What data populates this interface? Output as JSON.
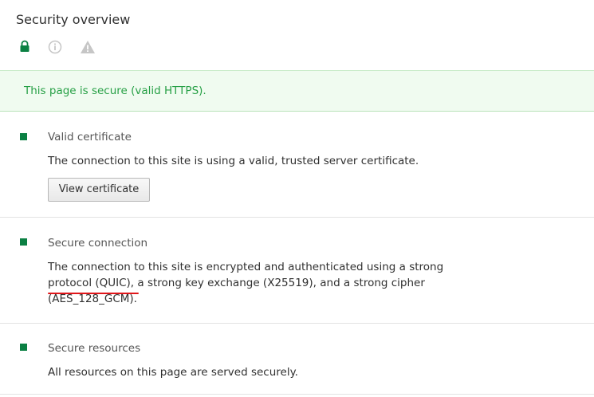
{
  "panel": {
    "title": "Security overview",
    "icons": {
      "secure": "lock-icon",
      "info": "info-icon",
      "warning": "warning-icon"
    }
  },
  "summary": {
    "text": "This page is secure (valid HTTPS)."
  },
  "sections": [
    {
      "title": "Valid certificate",
      "body_lines": [
        "The connection to this site is using a valid, trusted server certificate."
      ],
      "button_label": "View certificate"
    },
    {
      "title": "Secure connection",
      "body_lines": [
        "The connection to this site is encrypted and authenticated using a strong",
        "protocol (QUIC), a strong key exchange (X25519), and a strong cipher",
        "(AES_128_GCM)."
      ]
    },
    {
      "title": "Secure resources",
      "body_lines": [
        "All resources on this page are served securely."
      ]
    }
  ],
  "colors": {
    "secure_green": "#0b8043",
    "summary_text": "#27a046",
    "summary_bg": "#f0fbf0",
    "annotation_red": "#e0161a",
    "inactive_icon": "#c6c6c6"
  }
}
